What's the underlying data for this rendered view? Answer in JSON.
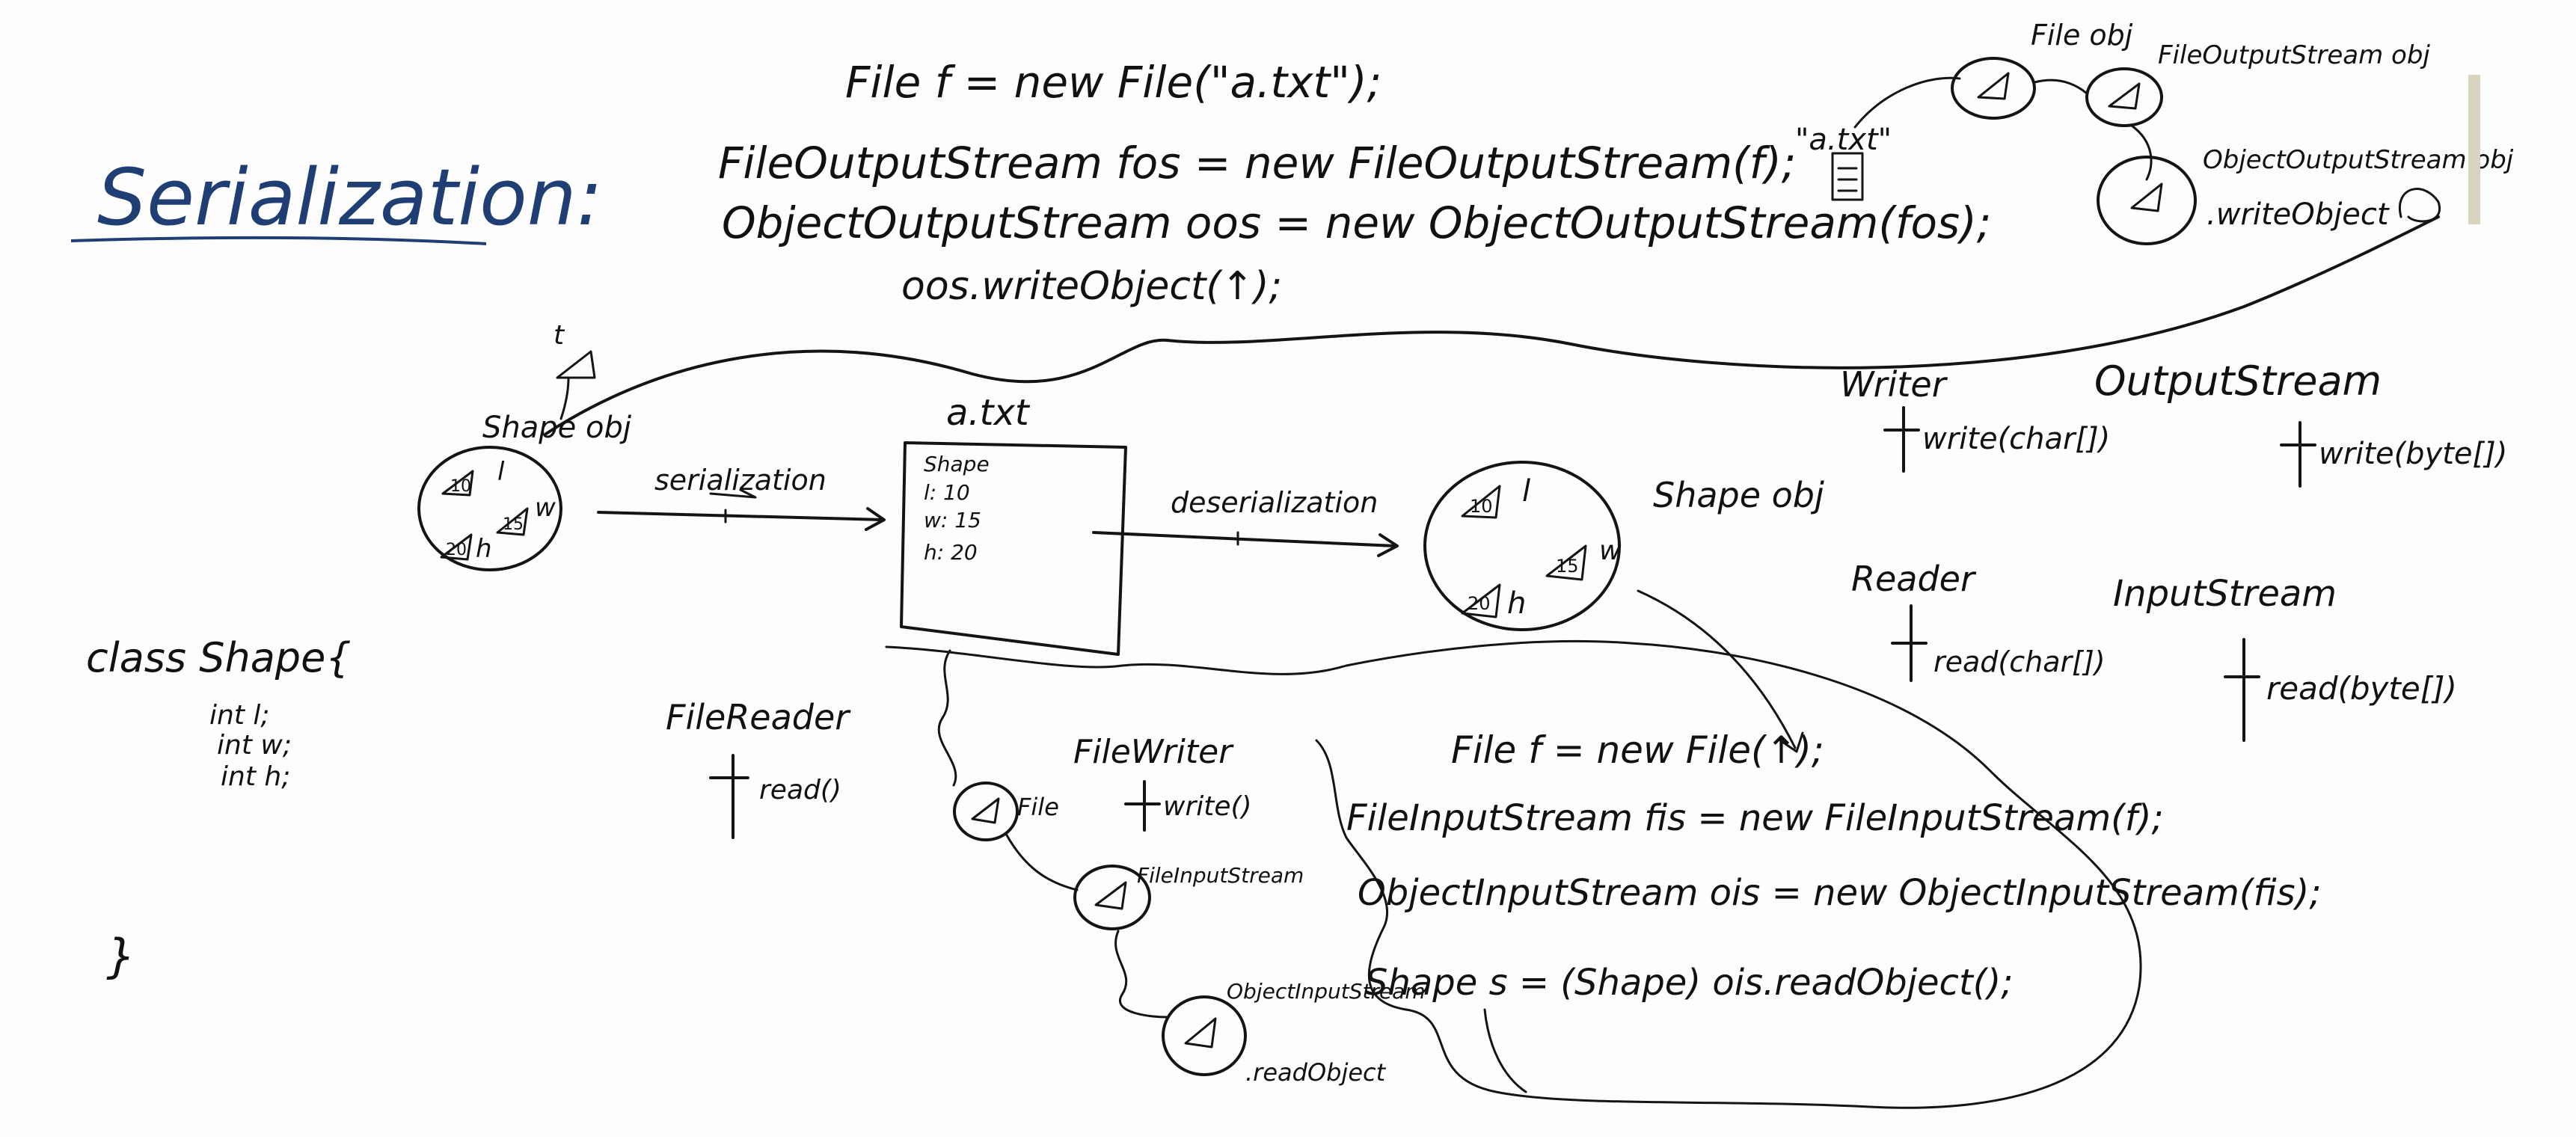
{
  "title": "Serialization:",
  "code_write": [
    "File f = new File(\"a.txt\");",
    "FileOutputStream fos = new FileOutputStream(f);",
    "ObjectOutputStream oos = new ObjectOutputStream(fos);",
    "oos.writeObject(↑);"
  ],
  "chain_top": {
    "file_label": "\"a.txt\"",
    "node1": "File obj",
    "node2": "FileOutputStream obj",
    "node3": "ObjectOutputStream obj",
    "method": ".writeObject"
  },
  "shape_left": {
    "label": "Shape obj",
    "t_label": "t",
    "values": {
      "l": "10",
      "w": "15",
      "h": "20"
    },
    "letters": {
      "l": "l",
      "w": "w",
      "h": "h"
    }
  },
  "serialization_label": "serialization",
  "deserialization_label": "deserialization",
  "file_box": {
    "title": "a.txt",
    "lines": [
      "Shape",
      "l: 10",
      "w: 15",
      "h: 20"
    ]
  },
  "shape_right": {
    "label": "Shape obj",
    "values": {
      "l": "10",
      "w": "15",
      "h": "20"
    },
    "letters": {
      "l": "l",
      "w": "w",
      "h": "h"
    }
  },
  "streams": {
    "writer": "Writer",
    "writer_method": "write(char[])",
    "outputstream": "OutputStream",
    "outputstream_method": "write(byte[])",
    "reader": "Reader",
    "reader_method": "read(char[])",
    "inputstream": "InputStream",
    "inputstream_method": "read(byte[])"
  },
  "class_def": {
    "header": "class Shape{",
    "fields": [
      "int  l;",
      "int  w;",
      "int  h;"
    ],
    "close": "}"
  },
  "filereader": {
    "label": "FileReader",
    "method": "read()"
  },
  "filewriter": {
    "label": "FileWriter",
    "method": "write()"
  },
  "chain_bottom": {
    "node1": "File",
    "node2": "FileInputStream",
    "node3": "ObjectInputStream",
    "method": ".readObject"
  },
  "code_read": [
    "File f = new File(↑);",
    "FileInputStream fis = new FileInputStream(f);",
    "ObjectInputStream ois = new ObjectInputStream(fis);",
    "Shape s = (Shape) ois.readObject();"
  ]
}
